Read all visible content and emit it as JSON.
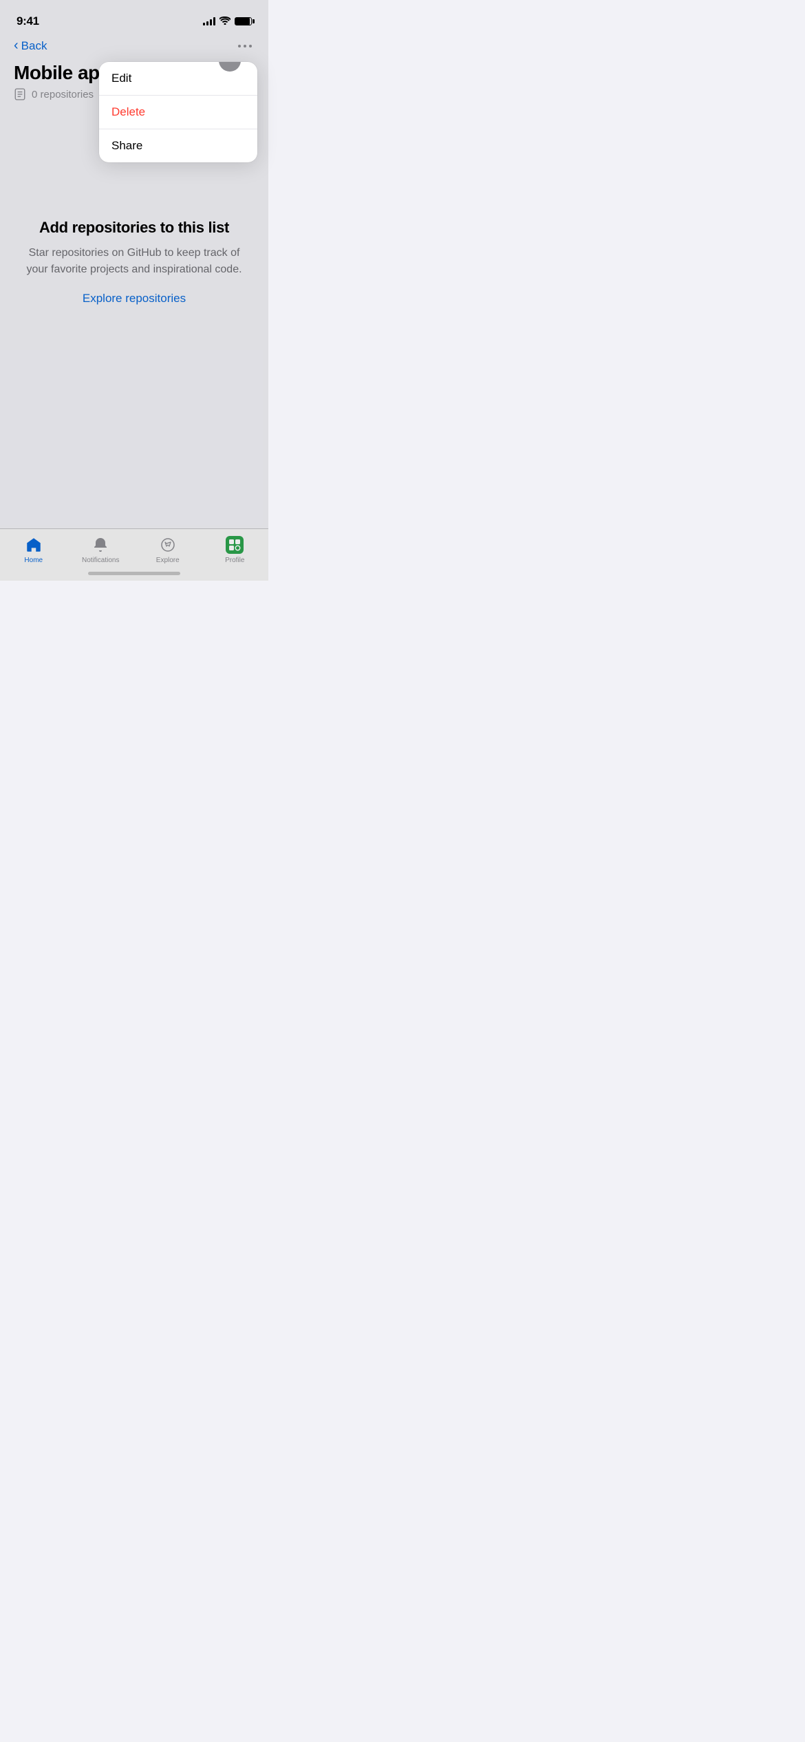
{
  "statusBar": {
    "time": "9:41",
    "battery": "100"
  },
  "header": {
    "backLabel": "Back",
    "moreLabel": "more options"
  },
  "page": {
    "title": "Mobile app",
    "repoCount": "0 repositories"
  },
  "dropdown": {
    "editLabel": "Edit",
    "deleteLabel": "Delete",
    "shareLabel": "Share"
  },
  "emptyState": {
    "title": "Add repositories to this list",
    "description": "Star repositories on GitHub to keep track of your favorite projects and inspirational code.",
    "exploreLink": "Explore repositories"
  },
  "tabBar": {
    "homeLabel": "Home",
    "notificationsLabel": "Notifications",
    "exploreLabel": "Explore",
    "profileLabel": "Profile"
  },
  "colors": {
    "accent": "#0969da",
    "delete": "#ff3b30",
    "green": "#2da44e"
  }
}
